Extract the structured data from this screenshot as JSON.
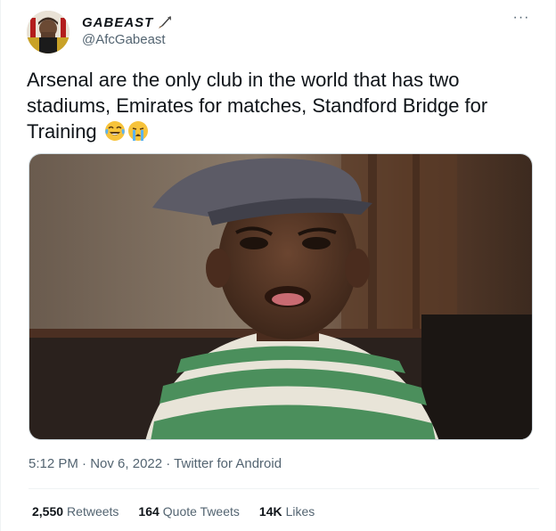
{
  "author": {
    "display_name": "GABEAST",
    "handle": "@AfcGabeast",
    "name_icon": "quill-pen-icon",
    "avatar_icon": "profile-avatar"
  },
  "more_icon": "more-dots-icon",
  "more_glyph": "···",
  "tweet": {
    "text": "Arsenal are the only club in the world that has two stadiums, Emirates for matches, Standford Bridge for Training",
    "emojis": [
      "laughing-tears-emoji",
      "crying-emoji"
    ]
  },
  "media": {
    "type": "image",
    "description_icon": "meme-photo"
  },
  "meta": {
    "time": "5:12 PM",
    "sep1": " · ",
    "date": "Nov 6, 2022",
    "sep2": " · ",
    "source": "Twitter for Android"
  },
  "stats": {
    "retweets_count": "2,550",
    "retweets_label": "Retweets",
    "quotes_count": "164",
    "quotes_label": "Quote Tweets",
    "likes_count": "14K",
    "likes_label": "Likes"
  },
  "colors": {
    "text": "#0f1419",
    "secondary": "#536471",
    "border": "#eff3f4"
  }
}
